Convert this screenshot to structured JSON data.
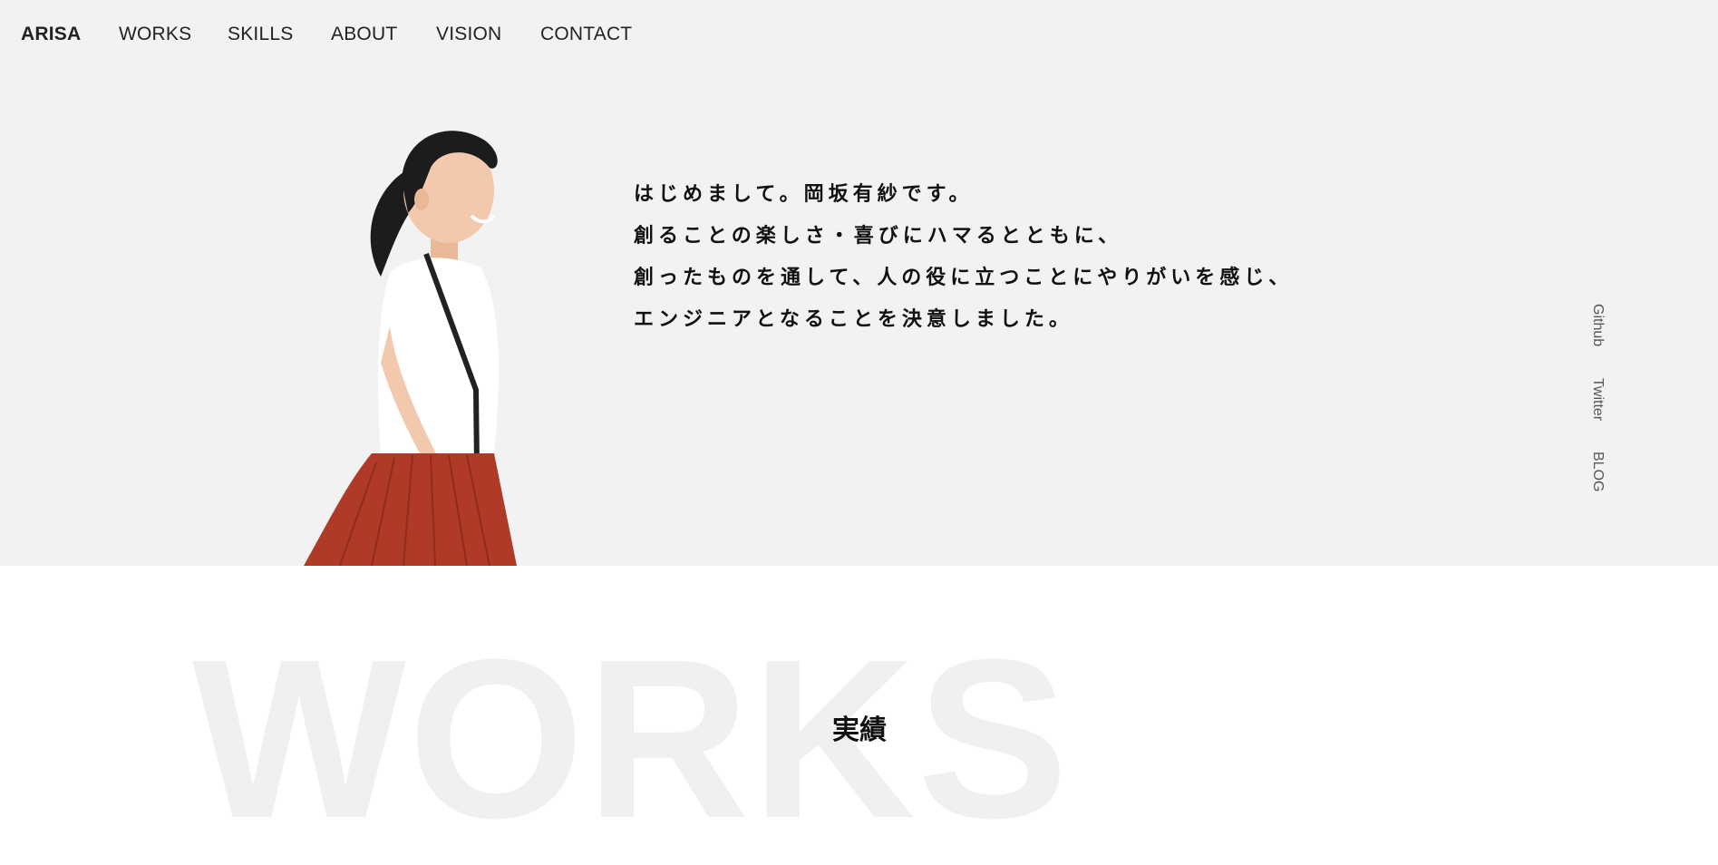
{
  "nav": {
    "brand": "ARISA",
    "items": [
      "WORKS",
      "SKILLS",
      "ABOUT",
      "VISION",
      "CONTACT"
    ]
  },
  "hero": {
    "lines": [
      "はじめまして。岡坂有紗です。",
      "創ることの楽しさ・喜びにハマるとともに、",
      "創ったものを通して、人の役に立つことにやりがいを感じ、",
      "エンジニアとなることを決意しました。"
    ],
    "portrait_icon": "person-photo-icon"
  },
  "social": {
    "links": [
      "Github",
      "Twitter",
      "BLOG"
    ]
  },
  "works": {
    "background_word": "WORKS",
    "title": "実績"
  },
  "colors": {
    "hero_bg": "#f2f2f2",
    "text": "#111111",
    "shirt": "#ffffff",
    "skirt": "#b03a28",
    "hair": "#1c1c1c",
    "skin": "#f2c9ad"
  }
}
